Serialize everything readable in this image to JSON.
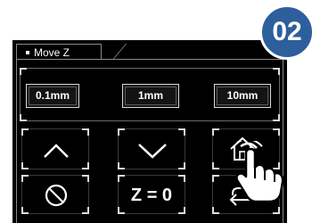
{
  "panel": {
    "title": "Move Z"
  },
  "step_buttons": [
    {
      "label": "0.1mm"
    },
    {
      "label": "1mm"
    },
    {
      "label": "10mm"
    }
  ],
  "actions": {
    "up": {
      "icon": "chevron-up-icon"
    },
    "down": {
      "icon": "chevron-down-icon"
    },
    "home": {
      "icon": "home-icon"
    },
    "stop": {
      "icon": "stop-circle-icon"
    },
    "zero": {
      "label": "Z = 0"
    },
    "back": {
      "icon": "return-arrow-icon"
    }
  },
  "badge": {
    "label": "02"
  },
  "colors": {
    "background": "#000000",
    "badge": "#2d5f9c",
    "text": "#ffffff"
  }
}
